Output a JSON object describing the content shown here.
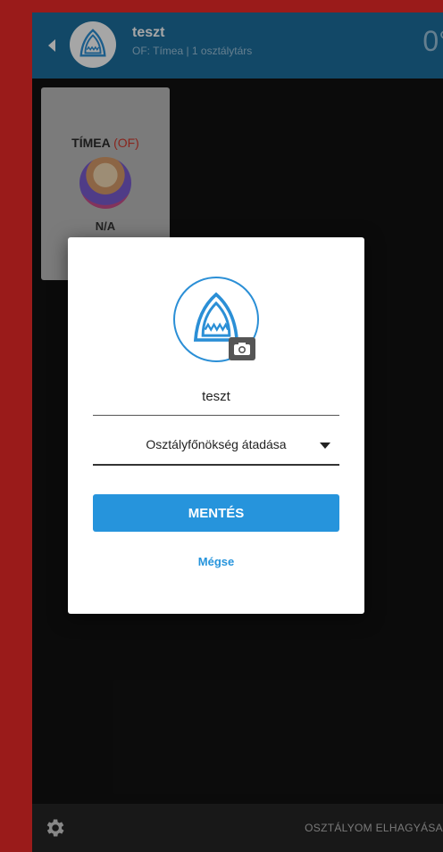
{
  "header": {
    "title": "teszt",
    "subtitle": "OF: Tímea | 1 osztálytárs",
    "right_text": "0°"
  },
  "member_card": {
    "name": "TÍMEA",
    "role": "(OF)",
    "status": "N/A"
  },
  "modal": {
    "class_name": "teszt",
    "select_value": "Osztályfőnökség átadása",
    "save_label": "MENTÉS",
    "cancel_label": "Mégse"
  },
  "footer": {
    "leave_label": "OSZTÁLYOM ELHAGYÁSA"
  },
  "colors": {
    "accent": "#2694dc",
    "header": "#1d6f9e",
    "frame": "#9a1b1a",
    "role": "#d23a2e"
  },
  "icons": {
    "back": "back-arrow-icon",
    "logo": "shark-logo-icon",
    "camera": "camera-icon",
    "settings": "gear-icon",
    "dropdown": "caret-down-icon"
  }
}
